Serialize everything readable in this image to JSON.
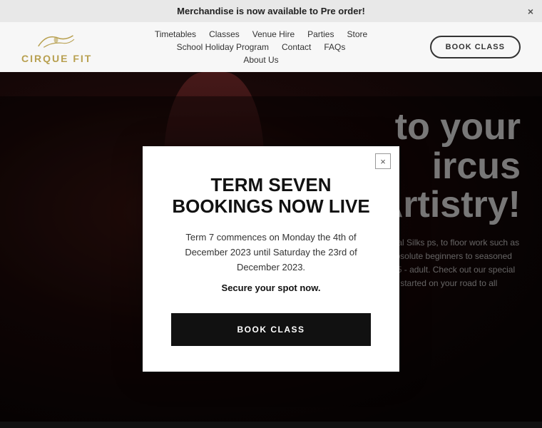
{
  "announcement": {
    "text": "Merchandise is now available to Pre order!",
    "close_label": "×"
  },
  "header": {
    "logo_text": "CIRQUE FIT",
    "nav": {
      "row1": [
        {
          "label": "Timetables"
        },
        {
          "label": "Classes"
        },
        {
          "label": "Venue Hire"
        },
        {
          "label": "Parties"
        },
        {
          "label": "Store"
        }
      ],
      "row2": [
        {
          "label": "School Holiday Program"
        },
        {
          "label": "Contact"
        },
        {
          "label": "FAQs"
        }
      ],
      "row3": [
        {
          "label": "About Us"
        }
      ]
    },
    "book_button": "BOOK CLASS"
  },
  "hero": {
    "heading_line1": "to your",
    "heading_line2": "ircus",
    "heading_line3": "Artistry!",
    "subtext": "us classes from Aerial Silks ps, to floor work such as hula We welcome absolute beginners to seasoned professionals, ages 5 - adult. Check out our special offers below and get started on your road to all things cirque!"
  },
  "modal": {
    "close_label": "×",
    "title": "TERM SEVEN\nBOOKINGS NOW LIVE",
    "body": "Term 7 commences on Monday the 4th of December 2023\nuntil Saturday the 23rd of December 2023.",
    "secure_text": "Secure your spot now.",
    "book_button": "BOOK CLASS"
  }
}
